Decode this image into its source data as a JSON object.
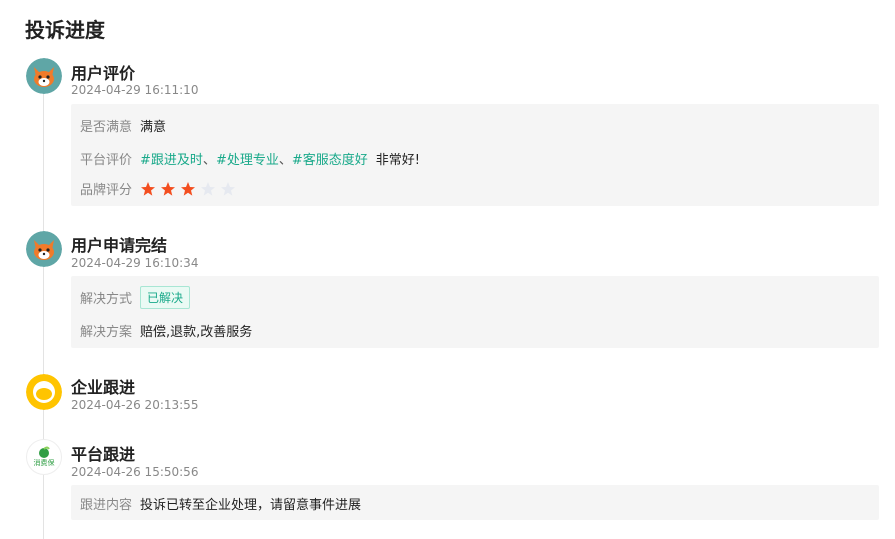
{
  "page": {
    "title": "投诉进度"
  },
  "events": [
    {
      "title": "用户评价",
      "time": "2024-04-29 16:11:10",
      "satisfied_label": "是否满意",
      "satisfied_value": "满意",
      "review_label": "平台评价",
      "review_tags": [
        "#跟进及时",
        "#处理专业",
        "#客服态度好"
      ],
      "tag_separator": "、",
      "review_text": "非常好!",
      "brand_label": "品牌评分",
      "brand_rating": 3,
      "brand_rating_max": 5
    },
    {
      "title": "用户申请完结",
      "time": "2024-04-29 16:10:34",
      "method_label": "解决方式",
      "method_badge": "已解决",
      "plan_label": "解决方案",
      "plan_value": "赔偿,退款,改善服务"
    },
    {
      "title": "企业跟进",
      "time": "2024-04-26 20:13:55"
    },
    {
      "title": "平台跟进",
      "time": "2024-04-26 15:50:56",
      "content_label": "跟进内容",
      "content_value": "投诉已转至企业处理，请留意事件进展",
      "logo_text": "消费保"
    }
  ],
  "colors": {
    "accent": "#19a98a",
    "star_active": "#f34e1f",
    "star_inactive": "#e6e9f0",
    "detail_bg": "#f5f5f5"
  },
  "icons": {
    "user_avatar": "fox-avatar-icon",
    "company_avatar": "company-ring-icon",
    "platform_avatar": "xiaofeibao-logo-icon",
    "rating": "star-icon"
  }
}
